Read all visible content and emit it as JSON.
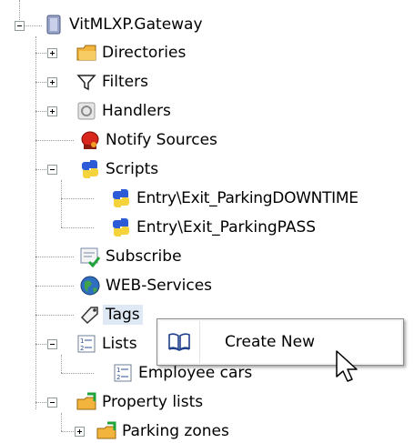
{
  "tree": {
    "root": {
      "label": "VitMLXP.Gateway",
      "icon": "server-icon"
    },
    "items": [
      {
        "label": "Directories",
        "icon": "folder-icon"
      },
      {
        "label": "Filters",
        "icon": "filter-icon"
      },
      {
        "label": "Handlers",
        "icon": "handlers-icon"
      },
      {
        "label": "Notify Sources",
        "icon": "alarm-icon"
      },
      {
        "label": "Scripts",
        "icon": "python-icon"
      },
      {
        "label": "Entry\\Exit_ParkingDOWNTIME",
        "icon": "python-icon"
      },
      {
        "label": "Entry\\Exit_ParkingPASS",
        "icon": "python-icon"
      },
      {
        "label": "Subscribe",
        "icon": "subscribe-icon"
      },
      {
        "label": "WEB-Services",
        "icon": "globe-icon"
      },
      {
        "label": "Tags",
        "icon": "tag-icon"
      },
      {
        "label": "Lists",
        "icon": "list-icon"
      },
      {
        "label": "Employee cars",
        "icon": "list-icon"
      },
      {
        "label": "Property lists",
        "icon": "property-list-icon"
      },
      {
        "label": "Parking zones",
        "icon": "property-list-icon"
      }
    ]
  },
  "context_menu": {
    "items": [
      {
        "label": "Create New",
        "icon": "book-icon"
      }
    ]
  },
  "colors": {
    "selection": "#dfe8f5",
    "tree_line": "#9a9a9a",
    "python_blue": "#2d5bd8",
    "python_yellow": "#f5d33a"
  }
}
